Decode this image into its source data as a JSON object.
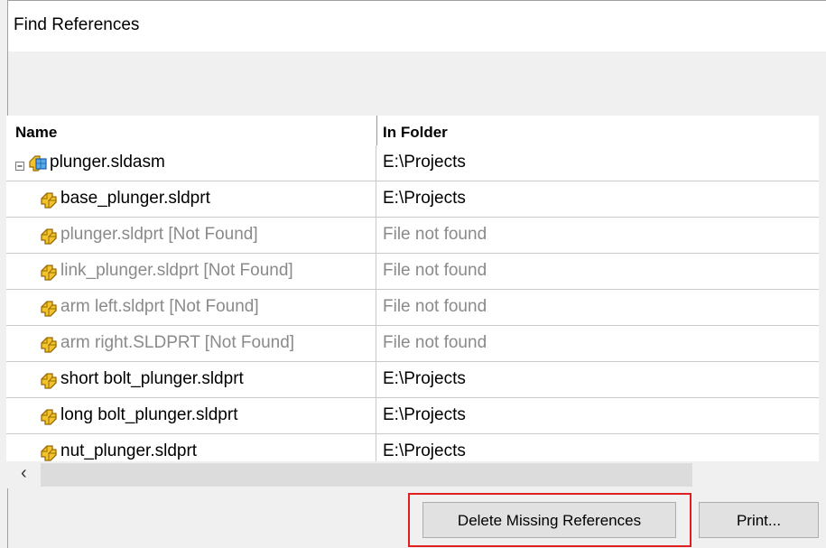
{
  "window": {
    "title": "Find References"
  },
  "table": {
    "columns": [
      "Name",
      "In Folder"
    ],
    "rows": [
      {
        "name": "plunger.sldasm",
        "folder": "E:\\Projects",
        "type": "assembly",
        "missing": false,
        "top": true
      },
      {
        "name": "base_plunger.sldprt",
        "folder": "E:\\Projects",
        "type": "part",
        "missing": false
      },
      {
        "name": "plunger.sldprt [Not Found]",
        "folder": "File not found",
        "type": "part",
        "missing": true
      },
      {
        "name": "link_plunger.sldprt [Not Found]",
        "folder": "File not found",
        "type": "part",
        "missing": true
      },
      {
        "name": "arm left.sldprt [Not Found]",
        "folder": "File not found",
        "type": "part",
        "missing": true
      },
      {
        "name": "arm right.SLDPRT [Not Found]",
        "folder": "File not found",
        "type": "part",
        "missing": true
      },
      {
        "name": "short bolt_plunger.sldprt",
        "folder": "E:\\Projects",
        "type": "part",
        "missing": false
      },
      {
        "name": "long bolt_plunger.sldprt",
        "folder": "E:\\Projects",
        "type": "part",
        "missing": false
      },
      {
        "name": "nut_plunger.sldprt",
        "folder": "E:\\Projects",
        "type": "part",
        "missing": false
      }
    ]
  },
  "buttons": {
    "delete_missing": "Delete Missing References",
    "print": "Print..."
  },
  "colors": {
    "highlight": "#e02020",
    "missing_text": "#8a8a8a"
  },
  "icons": {
    "expander": "collapse-minus-icon",
    "assembly": "assembly-icon",
    "part": "part-icon",
    "scroll_left": "chevron-left-icon"
  }
}
